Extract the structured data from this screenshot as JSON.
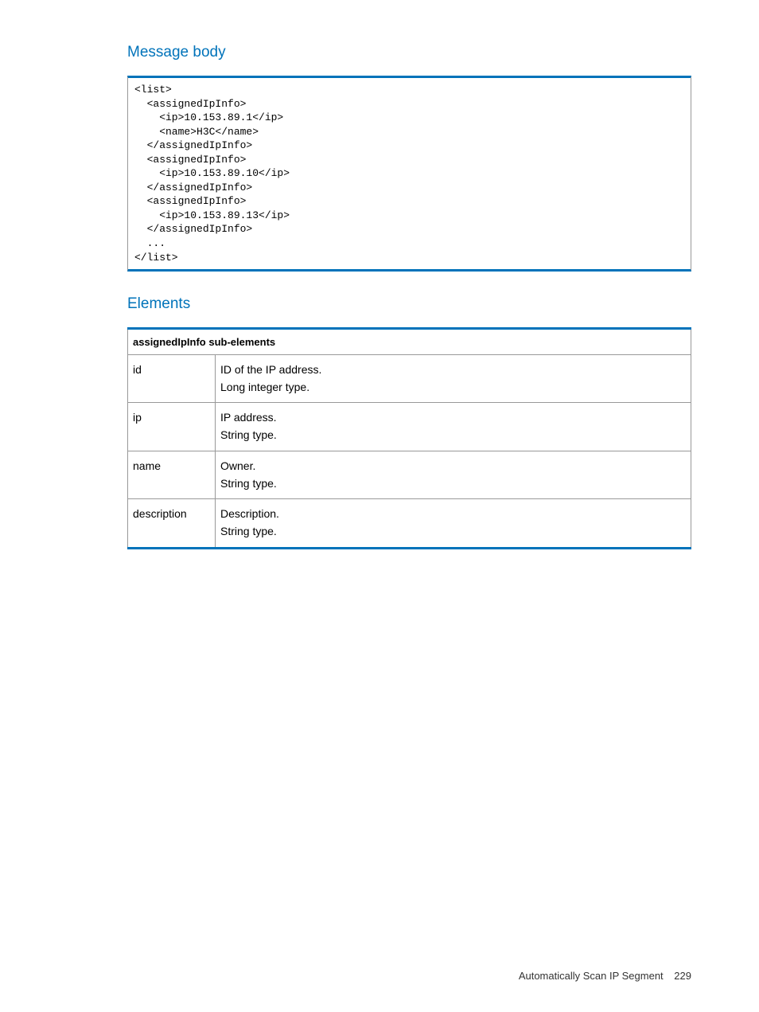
{
  "sections": {
    "message_body_heading": "Message body",
    "elements_heading": "Elements"
  },
  "code": "<list>\n  <assignedIpInfo>\n    <ip>10.153.89.1</ip>\n    <name>H3C</name>\n  </assignedIpInfo>\n  <assignedIpInfo>\n    <ip>10.153.89.10</ip>\n  </assignedIpInfo>\n  <assignedIpInfo>\n    <ip>10.153.89.13</ip>\n  </assignedIpInfo>\n  ...\n</list>",
  "table": {
    "header": "assignedIpInfo sub-elements",
    "rows": [
      {
        "name": "id",
        "desc": "ID of the IP address.\nLong integer type."
      },
      {
        "name": "ip",
        "desc": "IP address.\nString type."
      },
      {
        "name": "name",
        "desc": "Owner.\nString type."
      },
      {
        "name": "description",
        "desc": "Description.\nString type."
      }
    ]
  },
  "footer": {
    "title": "Automatically Scan IP Segment",
    "page": "229"
  }
}
